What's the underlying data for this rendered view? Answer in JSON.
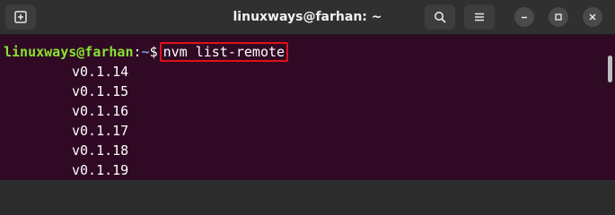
{
  "window": {
    "title": "linuxways@farhan: ~"
  },
  "icons": {
    "new_tab": "new-tab-icon",
    "search": "search-icon",
    "menu": "hamburger-menu-icon",
    "minimize": "minimize-icon",
    "maximize": "maximize-icon",
    "close": "close-icon"
  },
  "terminal": {
    "prompt_user": "linuxways@farhan",
    "prompt_colon": ":",
    "prompt_path": "~",
    "prompt_symbol": "$",
    "command": "nvm list-remote",
    "output": [
      "v0.1.14",
      "v0.1.15",
      "v0.1.16",
      "v0.1.17",
      "v0.1.18",
      "v0.1.19"
    ]
  },
  "colors": {
    "terminal_bg": "#300a24",
    "titlebar_bg": "#303030",
    "prompt_user": "#8ae234",
    "prompt_path": "#729fcf",
    "highlight_box": "#e0101e"
  }
}
